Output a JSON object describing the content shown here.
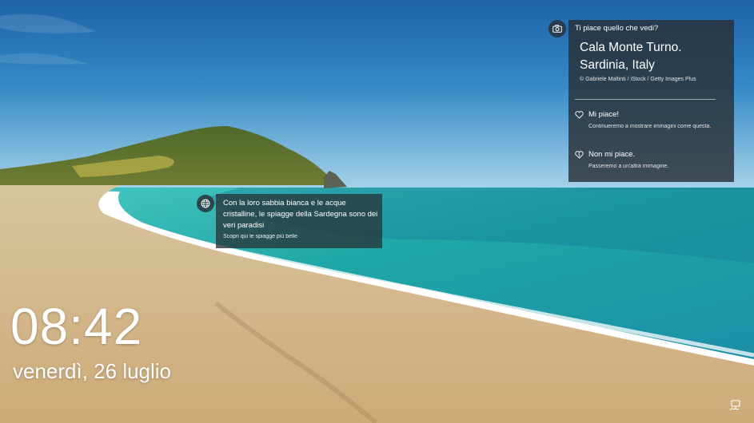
{
  "spotlight": {
    "question": "Ti piace quello che vedi?",
    "title_line1": "Cala Monte Turno.",
    "title_line2": "Sardinia, Italy",
    "credit": "© Gabriele Maltinti / iStock / Getty Images Plus",
    "like_label": "Mi piace!",
    "like_desc": "Continueremo a mostrare immagini come questa.",
    "dislike_label": "Non mi piace.",
    "dislike_desc": "Passeremo a un'altra immagine.",
    "camera_icon": "camera-icon",
    "heart_icon": "heart-icon"
  },
  "info_card": {
    "text": "Con la loro sabbia bianca e le acque cristalline, le spiagge della Sardegna sono dei veri paradisi",
    "link": "Scopri qui le spiagge più belle",
    "icon": "globe-icon"
  },
  "clock": {
    "time": "08:42",
    "date": "venerdì, 26 luglio"
  },
  "status": {
    "network_icon": "network-icon"
  }
}
